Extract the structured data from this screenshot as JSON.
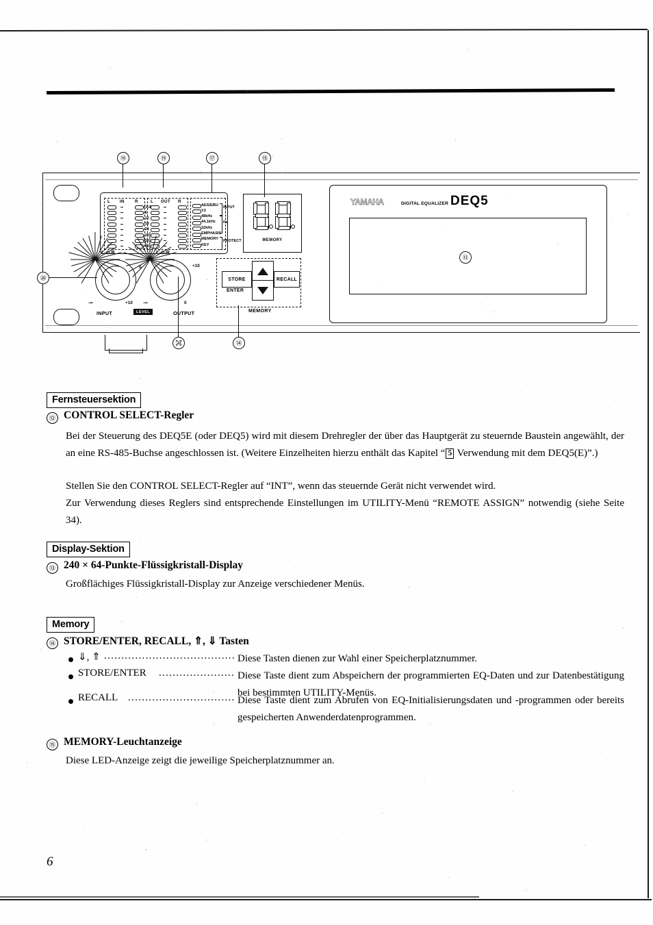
{
  "page": {
    "number": "6"
  },
  "figure": {
    "name": "DEQ5 front panel diagram",
    "brand": {
      "logo": "YAMAHA",
      "subtitle": "DIGITAL EQUALIZER",
      "model": "DEQ5"
    },
    "meters": {
      "in_header": {
        "left": "L",
        "center": "IN",
        "right": "R"
      },
      "out_header": {
        "left": "L",
        "center": "OUT",
        "right": "R"
      },
      "scale": [
        "CLIP",
        "-6",
        "-12",
        "-18",
        "-24",
        "-30",
        "-36",
        "-42"
      ]
    },
    "indicators": {
      "items": [
        "AES/EBU",
        "Y2",
        "48kHz",
        "44.1kHz",
        "32kHz",
        "EMPHASIS",
        "MEMORY",
        "KEY"
      ],
      "groups": [
        {
          "label": "INPUT"
        },
        {
          "label": "Fs"
        },
        {
          "label": "PROTECT"
        }
      ]
    },
    "memory_display": {
      "label": "MEMORY",
      "digits": [
        "8",
        "8"
      ]
    },
    "knobs": [
      {
        "name": "INPUT",
        "top_label": "L-⊙-R",
        "min_label": "-∞",
        "max_label": "+10",
        "right_label": "0"
      },
      {
        "name": "OUTPUT",
        "top_label": "L-⊙-R",
        "min_label": "-∞",
        "max_label": "0",
        "right_label": "+10"
      }
    ],
    "level_badge": "LEVEL",
    "memory_buttons": {
      "group_label": "MEMORY",
      "store": "STORE",
      "enter": "ENTER",
      "recall": "RECALL",
      "up_icon": "triangle-up-icon",
      "down_icon": "triangle-down-icon"
    },
    "callouts": [
      {
        "id": "c17",
        "label": "⑱"
      },
      {
        "id": "c18",
        "label": "⑲"
      },
      {
        "id": "c16",
        "label": "⑰"
      },
      {
        "id": "c15",
        "label": "⑮"
      },
      {
        "id": "c19",
        "label": "⑳"
      },
      {
        "id": "c20",
        "label": "㉉"
      },
      {
        "id": "c14",
        "label": "⑭"
      },
      {
        "id": "c13",
        "label": "⑬"
      }
    ]
  },
  "sections": [
    {
      "heading": "Fernsteuersektion",
      "item_number": "⑫",
      "item_title": "CONTROL SELECT-Regler",
      "paragraphs": [
        "Bei der Steuerung des DEQ5E (oder DEQ5) wird mit diesem Drehregler der über das Hauptgerät zu steuernde Baustein angewählt, der an eine RS-485-Buchse angeschlossen ist. (Weitere Einzelheiten hierzu enthält das Kapitel “",
        " Verwendung mit dem DEQ5(E)”.)",
        "Stellen Sie den CONTROL SELECT-Regler auf “INT”, wenn das steuernde Gerät nicht verwendet wird.",
        "Zur Verwendung dieses Reglers sind entsprechende Einstellungen im UTILITY-Menü “REMOTE ASSIGN” notwendig (siehe Seite 34)."
      ],
      "chapter_box": "5"
    },
    {
      "heading": "Display-Sektion",
      "item_number": "⑬",
      "item_title": "240 × 64-Punkte-Flüssigkristall-Display",
      "paragraphs": [
        "Großflächiges Flüssigkristall-Display zur Anzeige verschiedener Menüs."
      ]
    },
    {
      "heading": "Memory",
      "item_number": "⑭",
      "item_title": "STORE/ENTER, RECALL, ⇑, ⇓ Tasten",
      "bullets": [
        {
          "key": "⇓, ⇑",
          "leader": "..........................................",
          "desc": "Diese Tasten dienen zur Wahl einer Speicherplatznummer."
        },
        {
          "key": "STORE/ENTER",
          "leader": ".......................",
          "desc": "Diese Taste dient zum Abspeichern der programmierten EQ-Daten und zur Datenbestätigung bei bestimmten UTILITY-Menüs."
        },
        {
          "key": "RECALL",
          "leader": "................................",
          "desc": "Diese Taste dient zum Abrufen von EQ-Initialisierungsdaten und -programmen oder bereits gespeicherten Anwenderdatenprogrammen."
        }
      ],
      "item_number_2": "⑮",
      "item_title_2": "MEMORY-Leuchtanzeige",
      "paragraph_2": "Diese LED-Anzeige zeigt die jeweilige Speicherplatznummer an."
    }
  ]
}
